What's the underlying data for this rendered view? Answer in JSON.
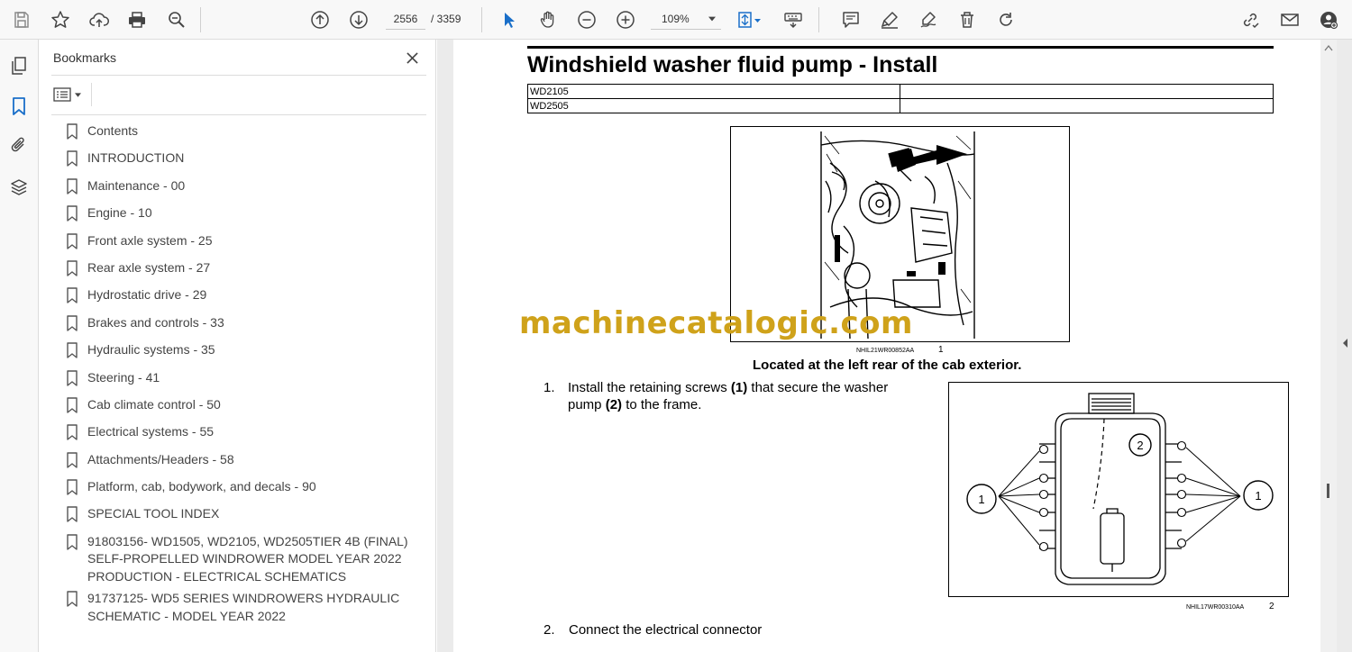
{
  "toolbar": {
    "page_current": "2556",
    "page_total": "/  3359",
    "zoom": "109%"
  },
  "bookmarks": {
    "title": "Bookmarks",
    "items": [
      {
        "label": "Contents"
      },
      {
        "label": "INTRODUCTION"
      },
      {
        "label": "Maintenance - 00"
      },
      {
        "label": "Engine - 10"
      },
      {
        "label": "Front axle system - 25"
      },
      {
        "label": "Rear axle system - 27"
      },
      {
        "label": "Hydrostatic drive - 29"
      },
      {
        "label": "Brakes and controls - 33"
      },
      {
        "label": "Hydraulic systems - 35"
      },
      {
        "label": "Steering - 41"
      },
      {
        "label": "Cab climate control - 50"
      },
      {
        "label": "Electrical systems - 55"
      },
      {
        "label": "Attachments/Headers - 58"
      },
      {
        "label": "Platform, cab, bodywork, and decals - 90"
      },
      {
        "label": "SPECIAL TOOL INDEX"
      },
      {
        "label": "91803156- WD1505, WD2105, WD2505TIER 4B (FINAL)\nSELF-PROPELLED WINDROWER MODEL YEAR 2022\nPRODUCTION - ELECTRICAL SCHEMATICS"
      },
      {
        "label": "91737125- WD5 SERIES WINDROWERS HYDRAULIC\nSCHEMATIC - MODEL YEAR 2022"
      }
    ]
  },
  "document": {
    "title": "Windshield washer fluid pump - Install",
    "models": [
      "WD2105",
      "WD2505"
    ],
    "figure1": {
      "code": "NHIL21WR00852AA",
      "number": "1",
      "caption": "Located at the left rear of the cab exterior."
    },
    "step1": {
      "number": "1.",
      "text_html": "Install the retaining screws <b>(1)</b> that secure the washer pump <b>(2)</b> to the frame."
    },
    "figure2": {
      "code": "NHIL17WR00310AA",
      "number": "2",
      "callout_1": "1",
      "callout_2": "2"
    },
    "step2": {
      "number": "2.",
      "text": "Connect the electrical connector"
    }
  },
  "watermark": "machinecatalogic.com",
  "colors": {
    "accent_blue": "#1a6fc9",
    "watermark": "#cfa21a"
  }
}
